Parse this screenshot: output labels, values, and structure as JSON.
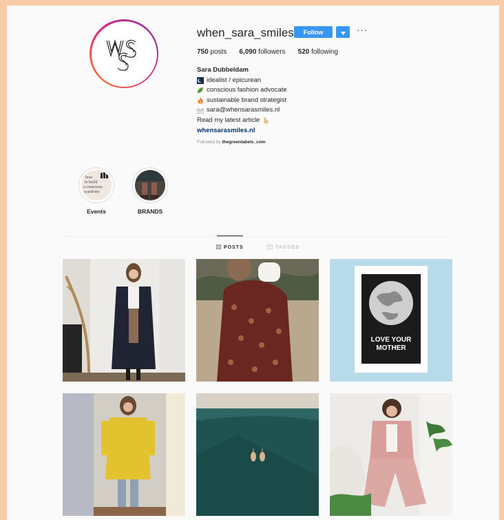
{
  "profile": {
    "username": "when_sara_smiles",
    "follow_label": "Follow",
    "more_label": "···",
    "logo_text": "WSS"
  },
  "stats": {
    "posts_count": "750",
    "posts_label": "posts",
    "followers_count": "6,090",
    "followers_label": "followers",
    "following_count": "520",
    "following_label": "following"
  },
  "bio": {
    "name": "Sara Dubbeldam",
    "lines": [
      {
        "icon": "moon-icon",
        "text": "idealist / epicurean"
      },
      {
        "icon": "leaf-icon",
        "text": "conscious fashion advocate"
      },
      {
        "icon": "fire-icon",
        "text": "sustainable brand strategist"
      },
      {
        "icon": "envelope-icon",
        "text": "sara@whensarasmiles.nl"
      }
    ],
    "article_text": "Read my latest article",
    "link": "whensarasmiles.nl",
    "followed_by_prefix": "Followed by",
    "followed_by_user": "thegreenlabels_com"
  },
  "highlights": [
    {
      "label": "Events",
      "thumb_text": "how to build a conscious wardrobe"
    },
    {
      "label": "BRANDS"
    }
  ],
  "tabs": [
    {
      "label": "POSTS",
      "icon": "grid-icon",
      "active": true
    },
    {
      "label": "TAGGED",
      "icon": "tag-icon",
      "active": false
    }
  ],
  "posts": [
    {
      "subject": "woman in long coat",
      "colors": [
        "#eceae5",
        "#1e2430"
      ]
    },
    {
      "subject": "woman in paisley coat",
      "colors": [
        "#b8a58a",
        "#6e2a22"
      ]
    },
    {
      "subject": "love your mother poster",
      "text": "LOVE YOUR MOTHER",
      "colors": [
        "#b9dcea",
        "#1a1a1a"
      ]
    },
    {
      "subject": "woman in yellow coat",
      "colors": [
        "#d9d6cf",
        "#e4c231"
      ]
    },
    {
      "subject": "earrings on green bag",
      "colors": [
        "#1f5553",
        "#d9d0c2"
      ]
    },
    {
      "subject": "woman in pink suit",
      "colors": [
        "#efeeeb",
        "#dca9a4"
      ]
    }
  ]
}
